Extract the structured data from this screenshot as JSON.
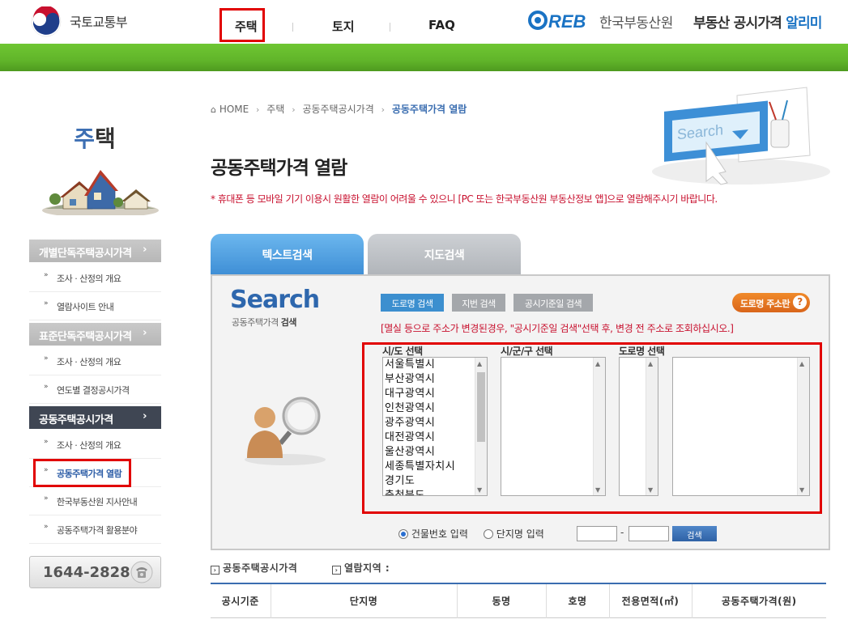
{
  "header": {
    "ministry_name": "국토교통부",
    "gnb": [
      "주택",
      "토지",
      "FAQ"
    ],
    "reb_logo": "REB",
    "reb_name": "한국부동산원",
    "service_name_main": "부동산 공시가격",
    "service_name_accent": "알리미"
  },
  "sidebar": {
    "title_part1": "주",
    "title_part2": "택",
    "groups": [
      {
        "label": "개별단독주택공시가격",
        "items": [
          "조사 · 산정의 개요",
          "열람사이트 안내"
        ]
      },
      {
        "label": "표준단독주택공시가격",
        "items": [
          "조사 · 산정의 개요",
          "연도별 결정공시가격"
        ]
      },
      {
        "label": "공동주택공시가격",
        "items": [
          "조사 · 산정의 개요",
          "공동주택가격 열람",
          "한국부동산원 지사안내",
          "공동주택가격 활용분야"
        ]
      }
    ],
    "arrow": "›",
    "phone": "1644-2828"
  },
  "breadcrumb": {
    "home": "HOME",
    "items": [
      "주택",
      "공동주택공시가격"
    ],
    "current": "공동주택가격 열람",
    "sep": "›"
  },
  "page_title": "공동주택가격 열람",
  "notice": "* 휴대폰 등 모바일 기기 이용시 원활한 열람이 어려울 수 있으니 [PC 또는 한국부동산원 부동산정보 앱]으로 열람해주시기 바랍니다.",
  "illustration_text": "Search",
  "tabs": {
    "text_search": "텍스트검색",
    "map_search": "지도검색"
  },
  "search": {
    "logo": "Search",
    "sub_normal": "공동주택가격",
    "sub_bold": "검색",
    "buttons": {
      "road": "도로명 검색",
      "jibun": "지번 검색",
      "date": "공시기준일 검색",
      "road_info": "도로명 주소란",
      "road_info_icon": "?"
    },
    "warning": "[멸실 등으로 주소가 변경된경우, \"공시기준일 검색\"선택 후, 변경 전 주소로 조회하십시오.]",
    "labels": {
      "sido": "시/도 선택",
      "sigungu": "시/군/구 선택",
      "road": "도로명 선택"
    },
    "sido_options": [
      "서울특별시",
      "부산광역시",
      "대구광역시",
      "인천광역시",
      "광주광역시",
      "대전광역시",
      "울산광역시",
      "세종특별자치시",
      "경기도",
      "충청북도"
    ],
    "radio": {
      "building": "건물번호 입력",
      "complex": "단지명 입력",
      "selected": "building"
    },
    "dash": "-",
    "search_button": "검색"
  },
  "results": {
    "label_price": "공동주택공시가격",
    "label_region": "열람지역 :",
    "columns": [
      "공시기준",
      "단지명",
      "동명",
      "호명",
      "전용면적(㎡)",
      "공동주택가격(원)"
    ]
  }
}
